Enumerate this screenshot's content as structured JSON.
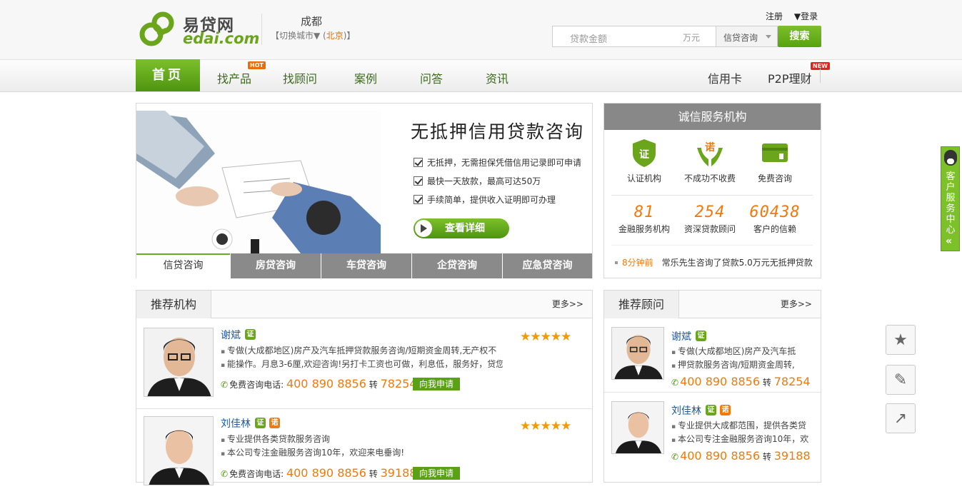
{
  "header": {
    "logo_cn": "易贷网",
    "logo_en": "edai.com",
    "city": "成都",
    "city_switch_prefix": "【切换城市▼ (",
    "city_switch_link": "北京",
    "city_switch_suffix": ")】",
    "register": "注册",
    "login": "▼登录"
  },
  "search": {
    "placeholder": "贷款金额",
    "unit": "万元",
    "category": "信贷咨询",
    "button": "搜索"
  },
  "nav": {
    "home": "首页",
    "items": [
      "找产品",
      "找顾问",
      "案例",
      "问答",
      "资讯"
    ],
    "right_items": [
      "信用卡",
      "P2P理财"
    ],
    "hot_tag": "HOT",
    "new_tag": "NEW"
  },
  "banner": {
    "headline": "无抵押信用贷款咨询",
    "bullets": [
      "无抵押，无需担保凭借信用记录即可申请",
      "最快一天放款，最高可达50万",
      "手续简单，提供收入证明即可办理"
    ],
    "detail_button": "查看详细",
    "tabs": [
      "信贷咨询",
      "房贷咨询",
      "车贷咨询",
      "企贷咨询",
      "应急贷咨询"
    ]
  },
  "trust": {
    "title": "诚信服务机构",
    "features": [
      "认证机构",
      "不成功不收费",
      "免费咨询"
    ],
    "feature_glyphs": [
      "证",
      "诺",
      ""
    ],
    "stats": [
      {
        "num": "81",
        "label": "金融服务机构"
      },
      {
        "num": "254",
        "label": "资深贷款顾问"
      },
      {
        "num": "60438",
        "label": "客户的信赖"
      }
    ],
    "news_time": "8分钟前",
    "news_text": "常乐先生咨询了贷款5.0万元无抵押贷款"
  },
  "orgs": {
    "title": "推荐机构",
    "more": "更多>>",
    "items": [
      {
        "name": "谢斌",
        "badges": [
          "证"
        ],
        "stars": "★★★★★",
        "lines": [
          "专做(大成都地区)房产及汽车抵押贷款服务咨询/短期资金周转,无产权不",
          "能操作。月息3-6厘,欢迎咨询!另打卡工资也可做，利息低，服务好，贷您"
        ],
        "phone_label": "免费咨询电话:",
        "phone": "400 890 8856",
        "ext_label": "转",
        "ext": "78254",
        "apply": "向我申请"
      },
      {
        "name": "刘佳林",
        "badges": [
          "证",
          "诺"
        ],
        "stars": "★★★★★",
        "lines": [
          "专业提供各类贷款服务咨询",
          "本公司专注金融服务咨询10年，欢迎来电垂询!"
        ],
        "phone_label": "免费咨询电话:",
        "phone": "400 890 8856",
        "ext_label": "转",
        "ext": "39188",
        "apply": "向我申请"
      }
    ]
  },
  "advisors": {
    "title": "推荐顾问",
    "more": "更多>>",
    "items": [
      {
        "name": "谢斌",
        "lines": [
          "专做(大成都地区)房产及汽车抵",
          "押贷款服务咨询/短期资金周转,"
        ],
        "phone": "400 890 8856",
        "ext_label": "转",
        "ext": "78254"
      },
      {
        "name": "刘佳林",
        "lines": [
          "专业提供大成都范围，提供各类贷",
          "本公司专注金融服务咨询10年，欢"
        ],
        "phone": "400 890 8856",
        "ext_label": "转",
        "ext": "39188"
      }
    ]
  },
  "sidebar": {
    "service": "客户服务中心",
    "collapse": "«"
  },
  "float_buttons": {
    "favorite": "★",
    "edit": "✎",
    "share": "↗"
  },
  "colors": {
    "brand_green": "#6aa51b",
    "accent_orange": "#f07a0e",
    "link_blue": "#1a5aa0"
  }
}
